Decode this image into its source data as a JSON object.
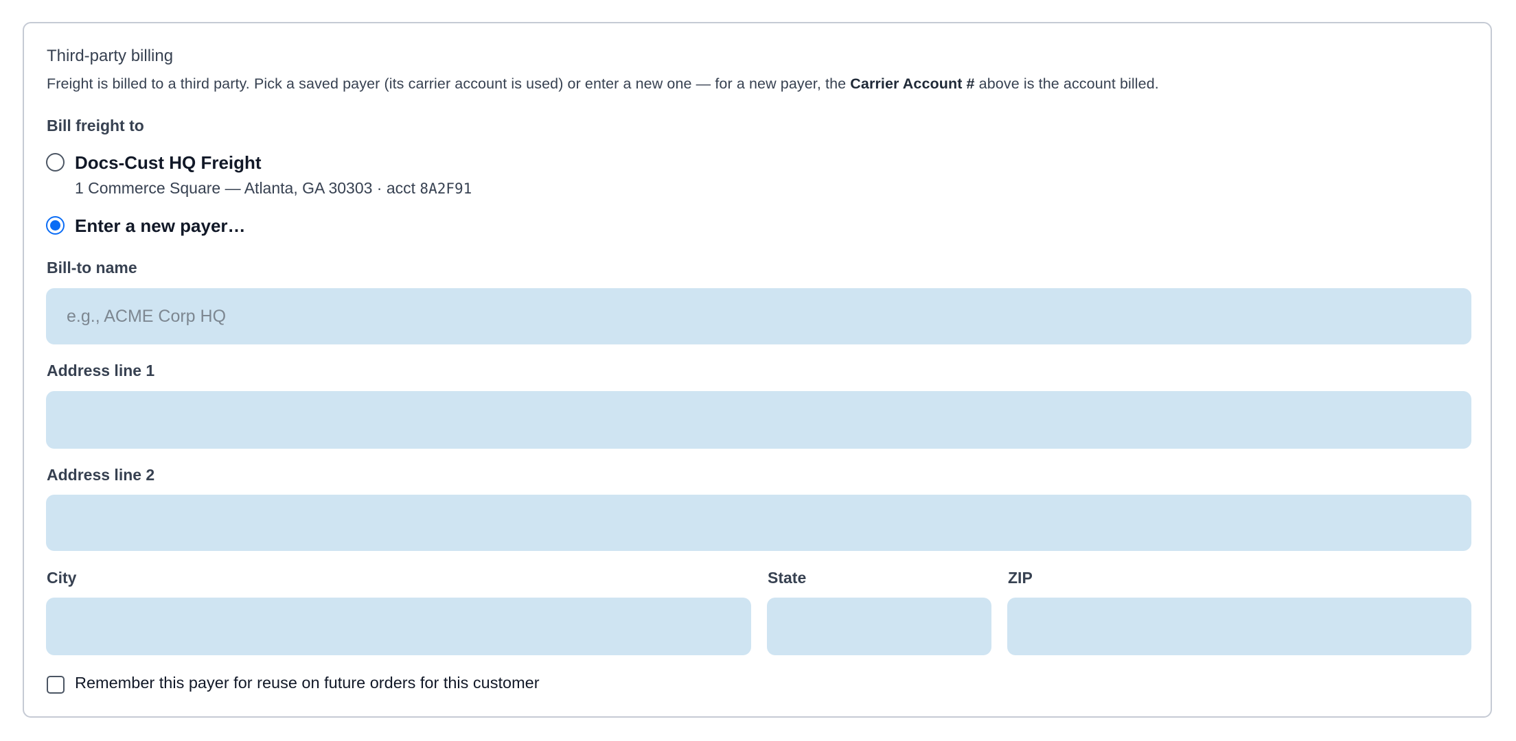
{
  "section": {
    "title": "Third-party billing",
    "help_before": "Freight is billed to a third party. Pick a saved payer (its carrier account is used) or enter a new one — for a new payer, the ",
    "help_bold": "Carrier Account #",
    "help_after": " above is the account billed."
  },
  "bill_freight": {
    "label": "Bill freight to",
    "options": [
      {
        "title": "Docs-Cust HQ Freight",
        "address": "1 Commerce Square — Atlanta, GA 30303 · acct ",
        "account": "8A2F91",
        "selected": false
      },
      {
        "title": "Enter a new payer…",
        "selected": true
      }
    ]
  },
  "form": {
    "bill_to_name": {
      "label": "Bill-to name",
      "placeholder": "e.g., ACME Corp HQ",
      "value": ""
    },
    "address_line_1": {
      "label": "Address line 1",
      "value": ""
    },
    "address_line_2": {
      "label": "Address line 2",
      "value": ""
    },
    "city": {
      "label": "City",
      "value": ""
    },
    "state": {
      "label": "State",
      "value": ""
    },
    "zip": {
      "label": "ZIP",
      "value": ""
    }
  },
  "remember": {
    "label": "Remember this payer for reuse on future orders for this customer",
    "checked": false
  },
  "colors": {
    "accent": "#0a6cf5",
    "input_bg": "#cfe4f2",
    "border": "#c5cad4"
  }
}
